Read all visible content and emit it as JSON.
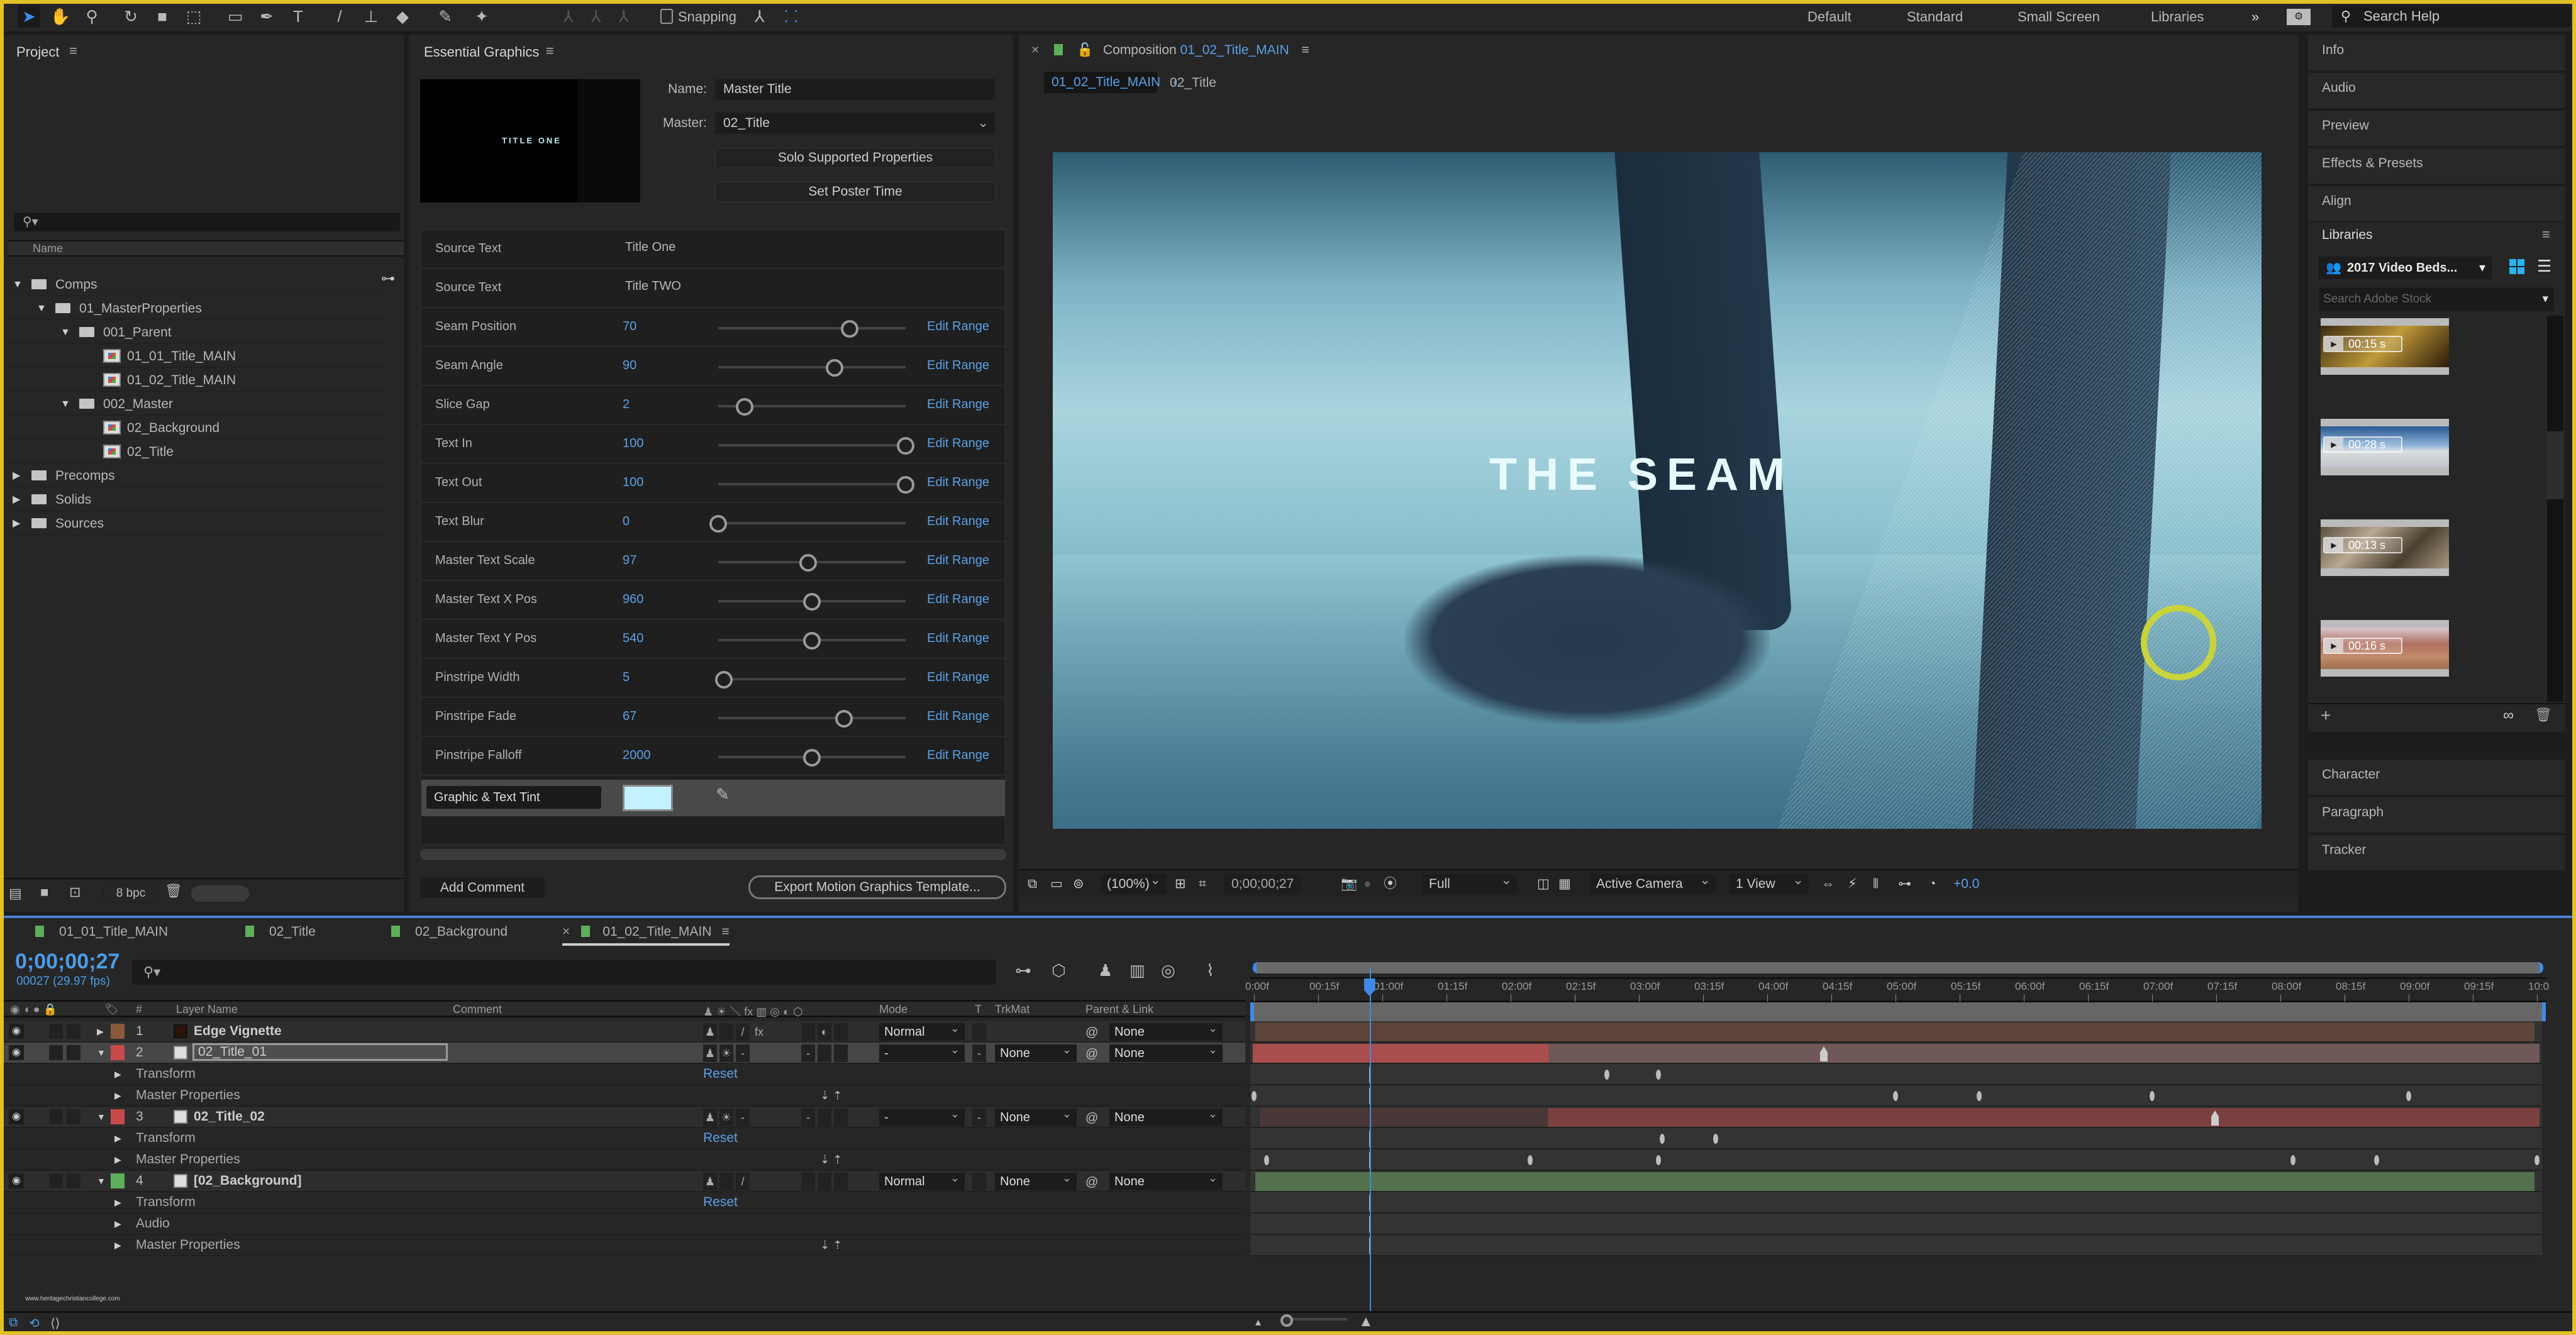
{
  "colors": {
    "accent": "#3f8ae8",
    "link_blue": "#5aa0e6",
    "frame_yellow": "#e1c126",
    "label_green": "#5fae5c",
    "label_red": "#c84a4a",
    "label_brown": "#8a5a3c",
    "tint_swatch": "#c3f1fe"
  },
  "toolbar": {
    "tools": [
      "selection-tool",
      "hand-tool",
      "zoom-tool",
      "rotation-tool",
      "camera-tool",
      "pan-behind-tool",
      "rectangle-tool",
      "pen-tool",
      "type-tool",
      "brush-tool",
      "clone-stamp-tool",
      "eraser-tool",
      "roto-brush-tool",
      "puppet-tool"
    ],
    "snapping_label": "Snapping",
    "workspaces": [
      "Default",
      "Standard",
      "Small Screen",
      "Libraries"
    ],
    "more": "»",
    "search_help_placeholder": "Search Help"
  },
  "project": {
    "title": "Project",
    "search_placeholder": "",
    "column_name": "Name",
    "items": [
      {
        "label": "Comps",
        "type": "folder",
        "expanded": true,
        "depth": 0
      },
      {
        "label": "01_MasterProperties",
        "type": "folder",
        "expanded": true,
        "depth": 1
      },
      {
        "label": "001_Parent",
        "type": "folder",
        "expanded": true,
        "depth": 2
      },
      {
        "label": "01_01_Title_MAIN",
        "type": "comp",
        "depth": 3
      },
      {
        "label": "01_02_Title_MAIN",
        "type": "comp",
        "depth": 3
      },
      {
        "label": "002_Master",
        "type": "folder",
        "expanded": true,
        "depth": 2
      },
      {
        "label": "02_Background",
        "type": "comp",
        "depth": 3
      },
      {
        "label": "02_Title",
        "type": "comp",
        "depth": 3
      },
      {
        "label": "Precomps",
        "type": "folder",
        "expanded": false,
        "depth": 0
      },
      {
        "label": "Solids",
        "type": "folder",
        "expanded": false,
        "depth": 0
      },
      {
        "label": "Sources",
        "type": "folder",
        "expanded": false,
        "depth": 0
      }
    ],
    "bpc": "8 bpc"
  },
  "essential_graphics": {
    "title": "Essential Graphics",
    "thumb_text": "TITLE ONE",
    "name_label": "Name:",
    "name_value": "Master Title",
    "master_label": "Master:",
    "master_value": "02_Title",
    "solo_button": "Solo Supported Properties",
    "poster_button": "Set Poster Time",
    "text_props": [
      {
        "label": "Source Text",
        "value": "Title One"
      },
      {
        "label": "Source Text",
        "value": "Title TWO"
      }
    ],
    "slider_props": [
      {
        "label": "Seam Position",
        "value": "70",
        "fraction": 0.7
      },
      {
        "label": "Seam Angle",
        "value": "90",
        "fraction": 0.62
      },
      {
        "label": "Slice Gap",
        "value": "2",
        "fraction": 0.14
      },
      {
        "label": "Text In",
        "value": "100",
        "fraction": 1.0
      },
      {
        "label": "Text Out",
        "value": "100",
        "fraction": 1.0
      },
      {
        "label": "Text Blur",
        "value": "0",
        "fraction": 0.0
      },
      {
        "label": "Master Text Scale",
        "value": "97",
        "fraction": 0.48
      },
      {
        "label": "Master Text X Pos",
        "value": "960",
        "fraction": 0.5
      },
      {
        "label": "Master Text Y Pos",
        "value": "540",
        "fraction": 0.5
      },
      {
        "label": "Pinstripe Width",
        "value": "5",
        "fraction": 0.03
      },
      {
        "label": "Pinstripe Fade",
        "value": "67",
        "fraction": 0.67
      },
      {
        "label": "Pinstripe Falloff",
        "value": "2000",
        "fraction": 0.5
      }
    ],
    "edit_range_label": "Edit Range",
    "tint_label": "Graphic & Text Tint",
    "add_comment": "Add Comment",
    "export_button": "Export Motion Graphics Template..."
  },
  "composition": {
    "tab_prefix": "Composition",
    "tab_name": "01_02_Title_MAIN",
    "breadcrumb": [
      "01_02_Title_MAIN",
      "02_Title"
    ],
    "viewer_title": "THE SEAM",
    "zoom": "(100%)",
    "timecode": "0;00;00;27",
    "resolution": "Full",
    "camera": "Active Camera",
    "views": "1 View",
    "exposure": "+0.0"
  },
  "right_panels": {
    "top": [
      "Info",
      "Audio",
      "Preview",
      "Effects & Presets",
      "Align"
    ],
    "libraries_title": "Libraries",
    "library_selected": "2017 Video Beds...",
    "stock_search_placeholder": "Search Adobe Stock",
    "stock_items": [
      {
        "duration": "00:15 s"
      },
      {
        "duration": "00:28 s"
      },
      {
        "duration": "00:13 s"
      },
      {
        "duration": "00:16 s"
      }
    ],
    "bottom": [
      "Character",
      "Paragraph",
      "Tracker"
    ]
  },
  "timeline": {
    "tabs": [
      "01_01_Title_MAIN",
      "02_Title",
      "02_Background",
      "01_02_Title_MAIN"
    ],
    "active_tab": "01_02_Title_MAIN",
    "timecode": "0;00;00;27",
    "frame_info": "00027 (29.97 fps)",
    "columns": {
      "num": "#",
      "layer_name": "Layer Name",
      "comment": "Comment",
      "mode": "Mode",
      "t": "T",
      "trkmat": "TrkMat",
      "parent": "Parent & Link"
    },
    "ruler_ticks": [
      "0:00f",
      "00:15f",
      "01:00f",
      "01:15f",
      "02:00f",
      "02:15f",
      "03:00f",
      "03:15f",
      "04:00f",
      "04:15f",
      "05:00f",
      "05:15f",
      "06:00f",
      "06:15f",
      "07:00f",
      "07:15f",
      "08:00f",
      "08:15f",
      "09:00f",
      "09:15f",
      "10:0"
    ],
    "current_time_fraction": 0.09,
    "layers": [
      {
        "num": "1",
        "name": "Edge Vignette",
        "mode": "Normal",
        "trkmat": "",
        "parent": "None",
        "label": "brown",
        "expanded": false
      },
      {
        "num": "2",
        "name": "02_Title_01",
        "mode": "-",
        "trkmat": "None",
        "parent": "None",
        "label": "red",
        "expanded": true,
        "selected": true,
        "children": [
          "Transform",
          "Master Properties"
        ]
      },
      {
        "num": "3",
        "name": "02_Title_02",
        "mode": "-",
        "trkmat": "None",
        "parent": "None",
        "label": "red",
        "expanded": true,
        "children": [
          "Transform",
          "Master Properties"
        ]
      },
      {
        "num": "4",
        "name": "[02_Background]",
        "mode": "Normal",
        "trkmat": "None",
        "parent": "None",
        "label": "green",
        "expanded": true,
        "children": [
          "Transform",
          "Audio",
          "Master Properties"
        ]
      }
    ],
    "reset_label": "Reset",
    "watermark": "www.heritagechristiancollege.com"
  }
}
